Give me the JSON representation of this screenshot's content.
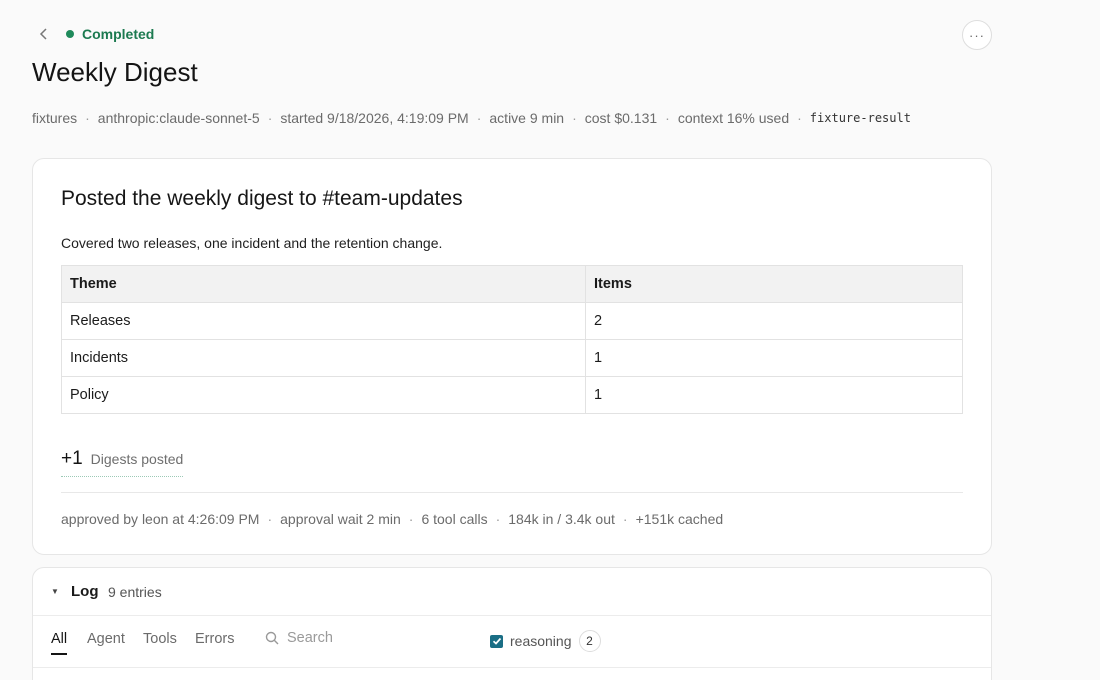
{
  "header": {
    "status": "Completed",
    "title": "Weekly Digest",
    "meta": {
      "project": "fixtures",
      "model": "anthropic:claude-sonnet-5",
      "started": "started 9/18/2026, 4:19:09 PM",
      "active": "active 9 min",
      "cost": "cost $0.131",
      "context": "context 16% used",
      "tag": "fixture-result"
    }
  },
  "result": {
    "title": "Posted the weekly digest to #team-updates",
    "description": "Covered two releases, one incident and the retention change.",
    "table": {
      "headers": [
        "Theme",
        "Items"
      ],
      "rows": [
        [
          "Releases",
          "2"
        ],
        [
          "Incidents",
          "1"
        ],
        [
          "Policy",
          "1"
        ]
      ]
    },
    "stat": {
      "value": "+1",
      "label": "Digests posted"
    },
    "footer": {
      "approved": "approved by leon at 4:26:09 PM",
      "wait": "approval wait 2 min",
      "tools": "6 tool calls",
      "tokens": "184k in / 3.4k out",
      "cached": "+151k cached"
    }
  },
  "log": {
    "title": "Log",
    "count": "9 entries",
    "tabs": [
      "All",
      "Agent",
      "Tools",
      "Errors"
    ],
    "search_placeholder": "Search",
    "reasoning_label": "reasoning",
    "reasoning_count": "2",
    "reasoning_checked": true
  },
  "colors": {
    "status_green": "#1f8a5b",
    "checkbox_teal": "#1a6e85"
  },
  "icons": [
    "chevron-left-icon",
    "more-horizontal-icon",
    "caret-down-icon",
    "search-icon",
    "check-icon"
  ]
}
